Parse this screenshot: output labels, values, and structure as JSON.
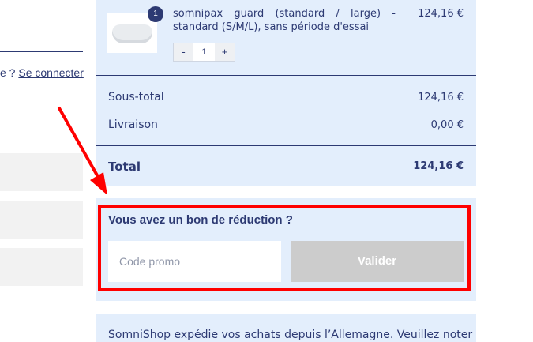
{
  "account": {
    "login_prefix": "e ? ",
    "login_link": "Se connecter"
  },
  "cart": {
    "item": {
      "quantity_badge": "1",
      "name": "somnipax guard (standard / large) - standard (S/M/L), sans période d'essai",
      "price": "124,16 €",
      "image_icon": "mouthguard-image",
      "stepper": {
        "minus": "-",
        "value": "1",
        "plus": "+"
      }
    },
    "subtotal": {
      "label": "Sous-total",
      "value": "124,16 €"
    },
    "shipping": {
      "label": "Livraison",
      "value": "0,00 €"
    },
    "total": {
      "label": "Total",
      "value": "124,16 €"
    }
  },
  "coupon": {
    "title": "Vous avez un bon de réduction ?",
    "placeholder": "Code promo",
    "button_label": "Valider",
    "highlight_color": "#ff0000"
  },
  "notice": {
    "text": "SomniShop expédie vos achats depuis l’Allemagne. Veuillez noter"
  },
  "colors": {
    "panel_bg": "#e3eefc",
    "text": "#2d3a73",
    "button_disabled": "#cccccc"
  }
}
